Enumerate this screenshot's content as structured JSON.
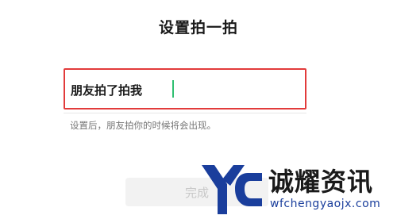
{
  "page": {
    "title": "设置拍一拍"
  },
  "input": {
    "value": "朋友拍了拍我"
  },
  "hint": "设置后，朋友拍你的时候将会出现。",
  "buttons": {
    "done_label": "完成"
  },
  "watermark": {
    "name": "诚耀资讯",
    "url": "wfchengyaojx.com"
  },
  "colors": {
    "highlight_border": "#e23b3b",
    "caret": "#2fbf71",
    "watermark_blue": "#1a3e9c"
  }
}
